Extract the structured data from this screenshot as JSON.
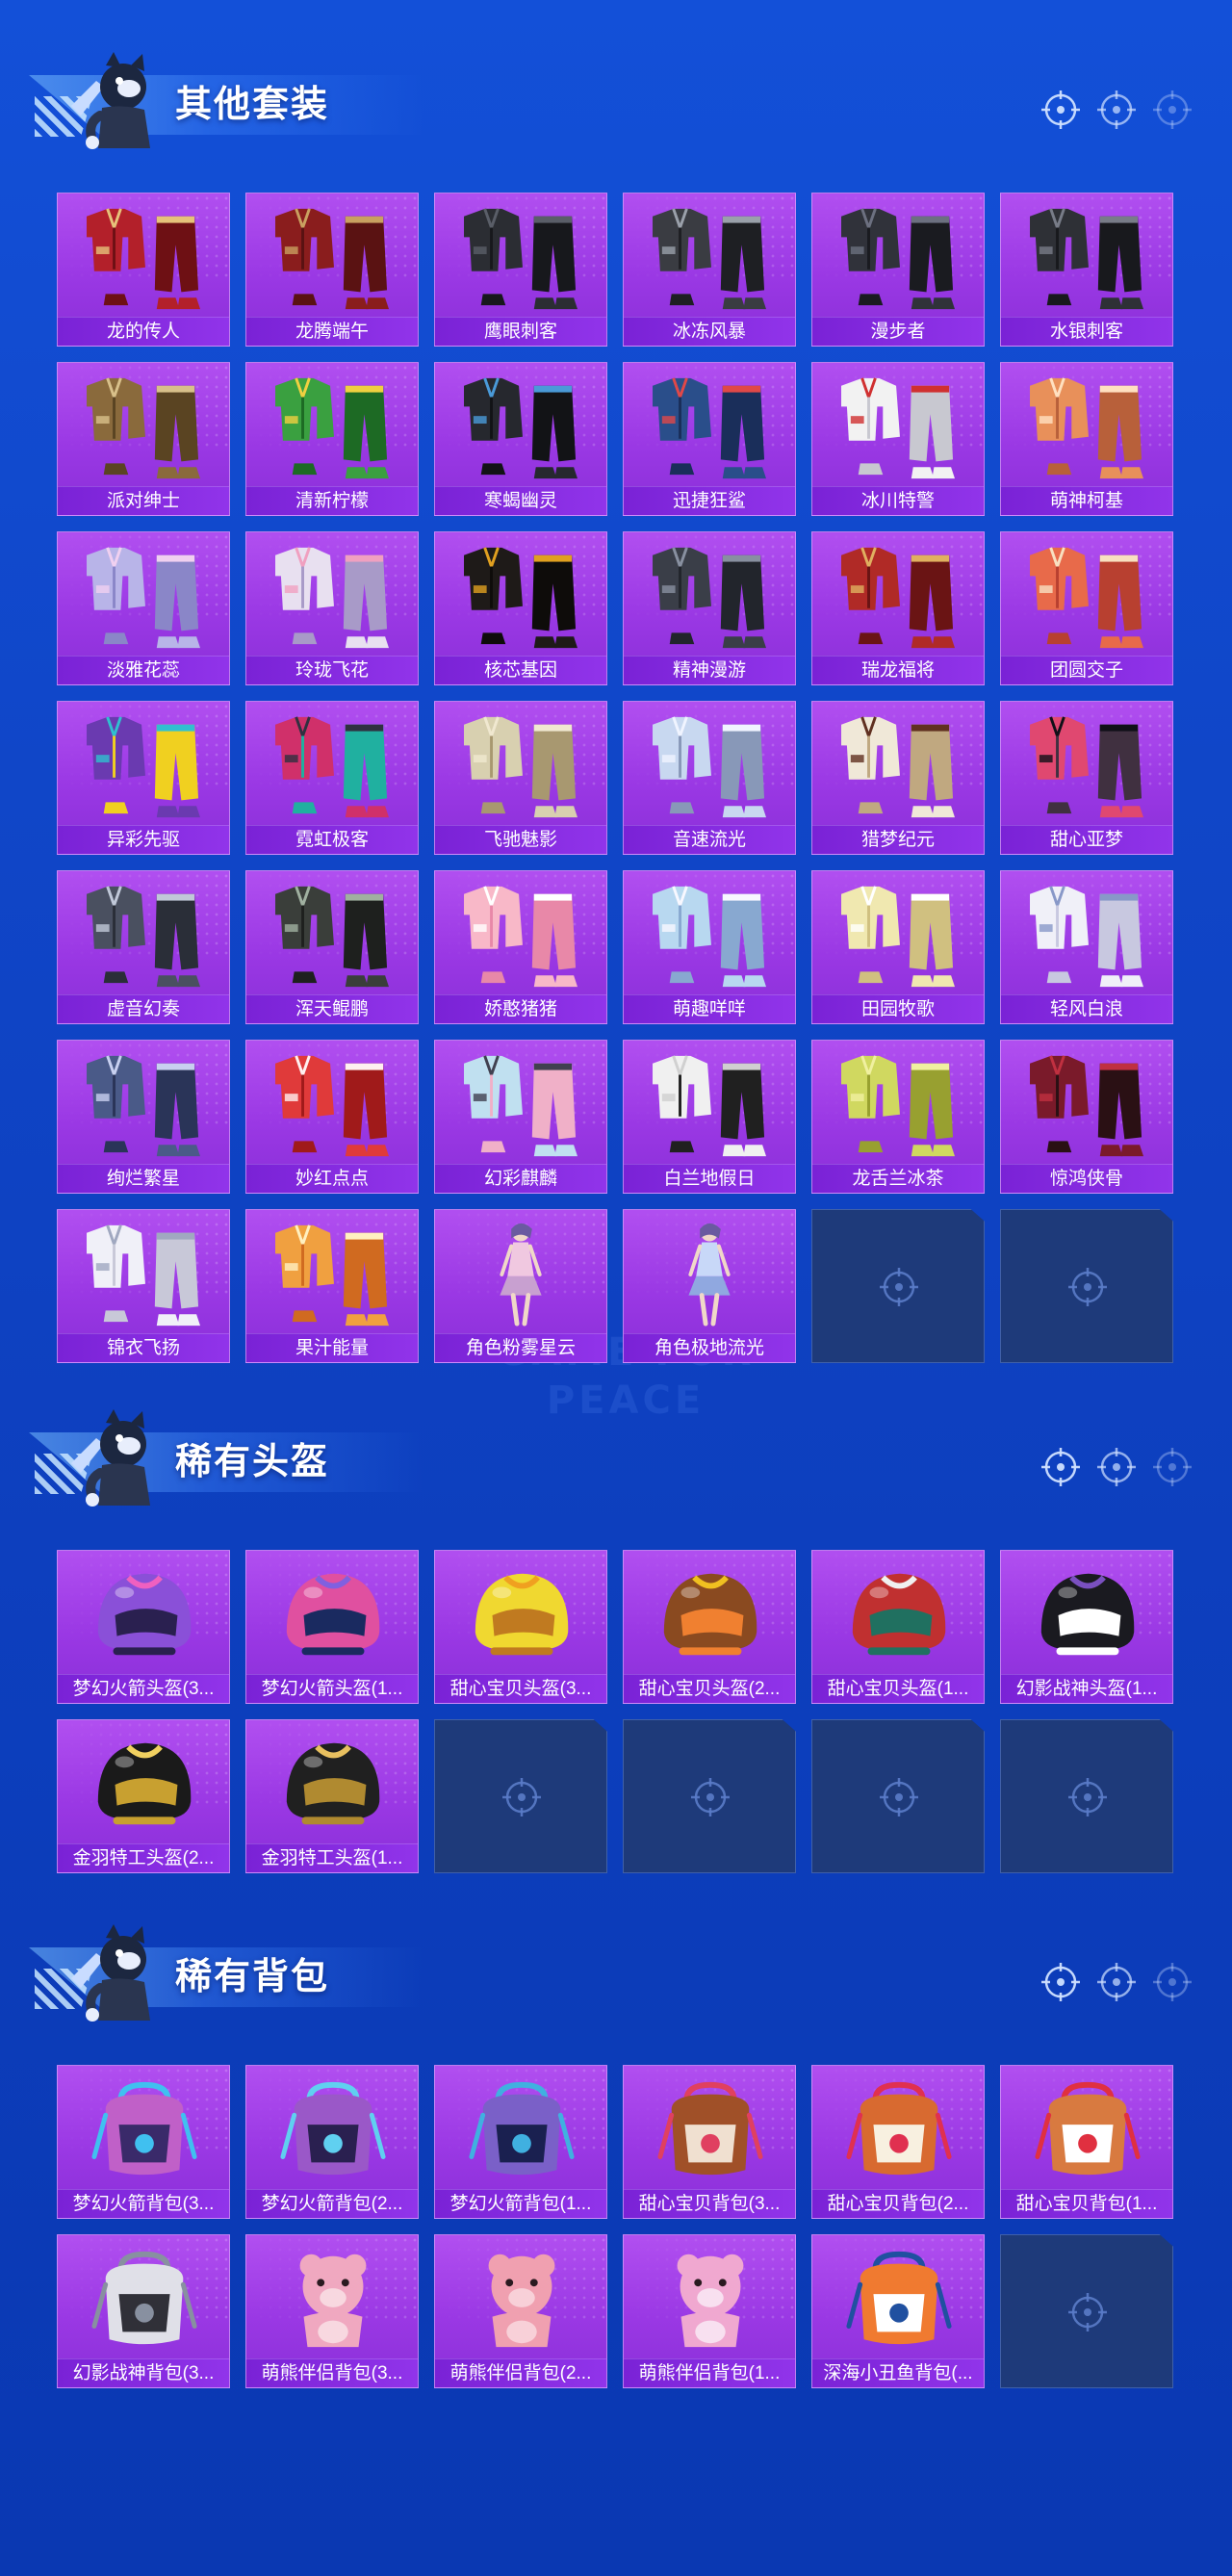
{
  "watermark": "GAME FOR PEACE",
  "colors": {
    "accent": "#1350d8",
    "card": "#9a38e4",
    "label_bar": "#7a22d6",
    "empty_slot": "#1e3a7a"
  },
  "sections": [
    {
      "title": "其他套装",
      "item_type": "outfit",
      "items": [
        "龙的传人",
        "龙腾端午",
        "鹰眼刺客",
        "冰冻风暴",
        "漫步者",
        "水银刺客",
        "派对绅士",
        "清新柠檬",
        "寒蝎幽灵",
        "迅捷狂鲨",
        "冰川特警",
        "萌神柯基",
        "淡雅花蕊",
        "玲珑飞花",
        "核芯基因",
        "精神漫游",
        "瑞龙福将",
        "团圆交子",
        "异彩先驱",
        "霓虹极客",
        "飞驰魅影",
        "音速流光",
        "猎梦纪元",
        "甜心亚梦",
        "虚音幻奏",
        "浑天鲲鹏",
        "娇憨猪猪",
        "萌趣咩咩",
        "田园牧歌",
        "轻风白浪",
        "绚烂繁星",
        "妙红点点",
        "幻彩麒麟",
        "白兰地假日",
        "龙舌兰冰茶",
        "惊鸿侠骨",
        "锦衣飞扬",
        "果汁能量",
        "角色粉雾星云",
        "角色极地流光"
      ],
      "empty_slots": 2
    },
    {
      "title": "稀有头盔",
      "item_type": "helmet",
      "items": [
        "梦幻火箭头盔(3...",
        "梦幻火箭头盔(1...",
        "甜心宝贝头盔(3...",
        "甜心宝贝头盔(2...",
        "甜心宝贝头盔(1...",
        "幻影战神头盔(1...",
        "金羽特工头盔(2...",
        "金羽特工头盔(1..."
      ],
      "empty_slots": 4
    },
    {
      "title": "稀有背包",
      "item_type": "backpack",
      "items": [
        "梦幻火箭背包(3...",
        "梦幻火箭背包(2...",
        "梦幻火箭背包(1...",
        "甜心宝贝背包(3...",
        "甜心宝贝背包(2...",
        "甜心宝贝背包(1...",
        "幻影战神背包(3...",
        "萌熊伴侣背包(3...",
        "萌熊伴侣背包(2...",
        "萌熊伴侣背包(1...",
        "深海小丑鱼背包(..."
      ],
      "empty_slots": 1
    }
  ]
}
